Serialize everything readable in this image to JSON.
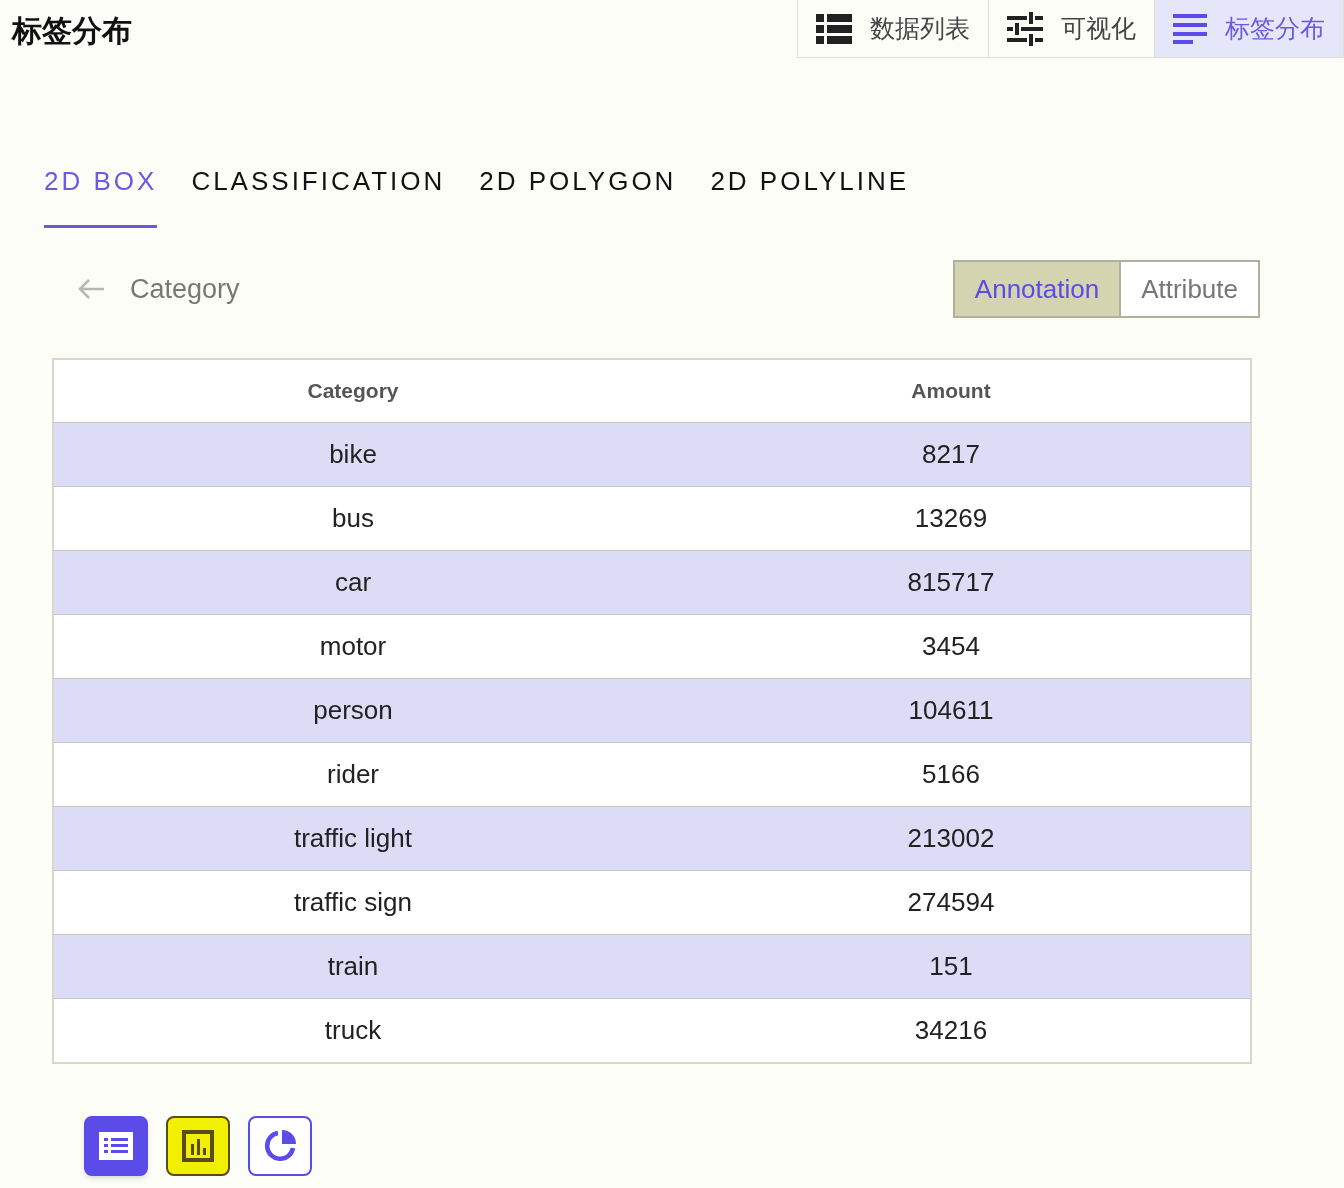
{
  "page_title": "标签分布",
  "nav": [
    {
      "label": "数据列表",
      "kind": "list",
      "selected": false
    },
    {
      "label": "可视化",
      "kind": "sliders",
      "selected": false
    },
    {
      "label": "标签分布",
      "kind": "lines",
      "selected": true
    }
  ],
  "label_tabs": [
    {
      "label": "2D BOX",
      "selected": true
    },
    {
      "label": "CLASSIFICATION",
      "selected": false
    },
    {
      "label": "2D POLYGON",
      "selected": false
    },
    {
      "label": "2D POLYLINE",
      "selected": false
    }
  ],
  "breadcrumb": "Category",
  "mode_toggle": [
    {
      "label": "Annotation",
      "selected": true
    },
    {
      "label": "Attribute",
      "selected": false
    }
  ],
  "table": {
    "columns": [
      "Category",
      "Amount"
    ],
    "rows": [
      [
        "bike",
        "8217"
      ],
      [
        "bus",
        "13269"
      ],
      [
        "car",
        "815717"
      ],
      [
        "motor",
        "3454"
      ],
      [
        "person",
        "104611"
      ],
      [
        "rider",
        "5166"
      ],
      [
        "traffic light",
        "213002"
      ],
      [
        "traffic sign",
        "274594"
      ],
      [
        "train",
        "151"
      ],
      [
        "truck",
        "34216"
      ]
    ]
  },
  "view_buttons": [
    {
      "kind": "table",
      "selected": true
    },
    {
      "kind": "bar",
      "selected": false
    },
    {
      "kind": "pie",
      "selected": false
    }
  ]
}
